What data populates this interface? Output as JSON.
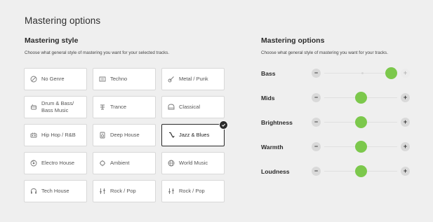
{
  "page": {
    "title": "Mastering options"
  },
  "style_panel": {
    "title": "Mastering style",
    "subtitle": "Choose what general style of mastering you want for your selected tracks.",
    "selected": "Jazz & Blues",
    "styles": [
      {
        "label": "No Genre",
        "icon": "no-genre-icon"
      },
      {
        "label": "Techno",
        "icon": "techno-icon"
      },
      {
        "label": "Metal / Punk",
        "icon": "guitar-icon"
      },
      {
        "label": "Drum & Bass/\nBass Music",
        "icon": "drum-icon"
      },
      {
        "label": "Trance",
        "icon": "trance-icon"
      },
      {
        "label": "Classical",
        "icon": "piano-icon"
      },
      {
        "label": "Hip Hop / R&B",
        "icon": "boombox-icon"
      },
      {
        "label": "Deep House",
        "icon": "speaker-icon"
      },
      {
        "label": "Jazz & Blues",
        "icon": "saxophone-icon",
        "selected": true
      },
      {
        "label": "Electro House",
        "icon": "vinyl-icon"
      },
      {
        "label": "Ambient",
        "icon": "ambient-icon"
      },
      {
        "label": "World Music",
        "icon": "globe-icon"
      },
      {
        "label": "Tech House",
        "icon": "headphones-icon"
      },
      {
        "label": "Rock / Pop",
        "icon": "mixer-icon"
      },
      {
        "label": "Rock / Pop",
        "icon": "mixer-icon"
      }
    ]
  },
  "options_panel": {
    "title": "Mastering options",
    "subtitle": "Choose what general style of mastering you want for your tracks.",
    "sliders": [
      {
        "label": "Bass",
        "value": 0.92,
        "plus_disabled": true,
        "marker": 0.52
      },
      {
        "label": "Mids",
        "value": 0.5
      },
      {
        "label": "Brightness",
        "value": 0.5
      },
      {
        "label": "Warmth",
        "value": 0.5
      },
      {
        "label": "Loudness",
        "value": 0.5
      }
    ],
    "minus_symbol": "−",
    "plus_symbol": "+"
  },
  "colors": {
    "accent": "#7cc84c",
    "selected_border": "#2a2a2a",
    "background": "#efefef"
  }
}
